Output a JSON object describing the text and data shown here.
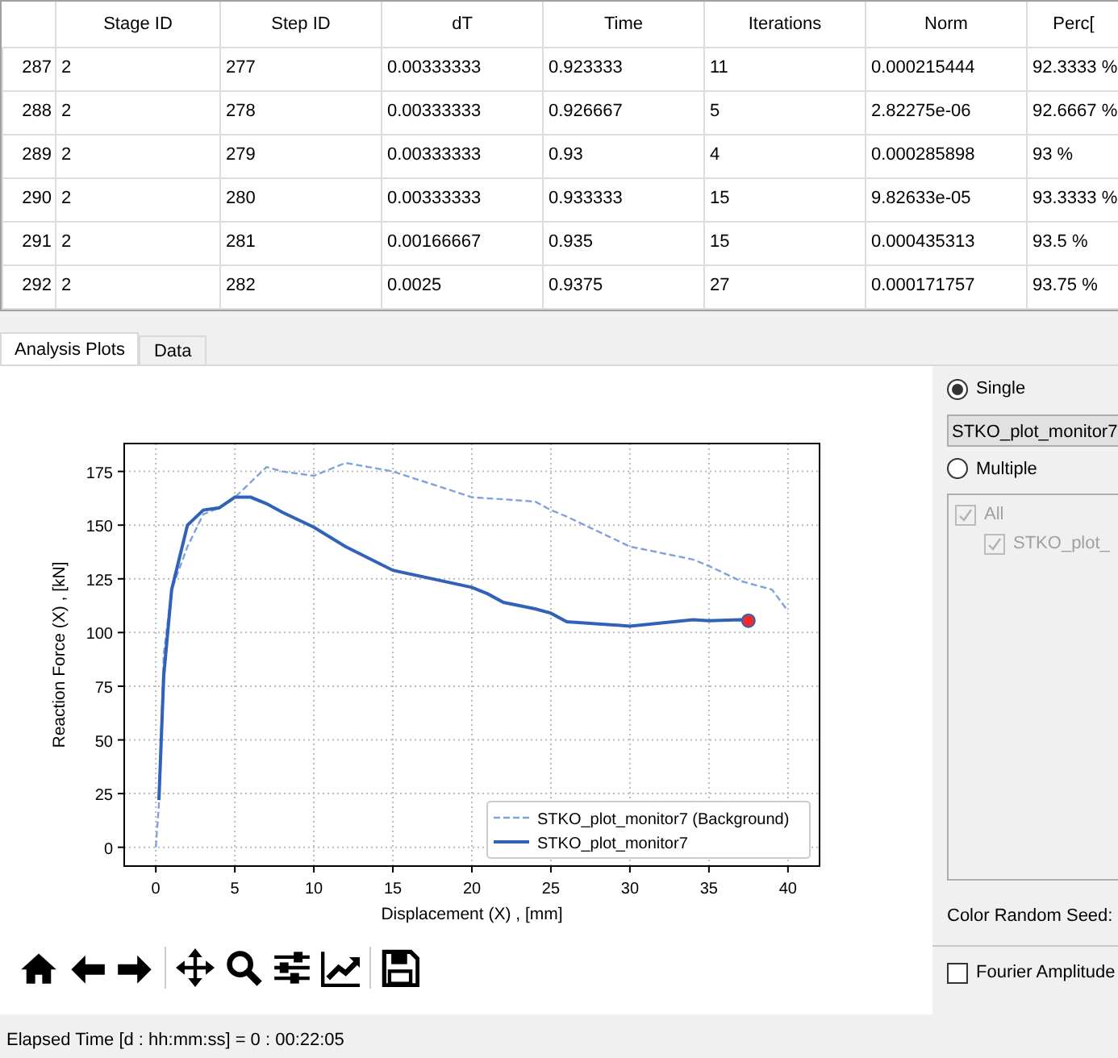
{
  "table": {
    "columns": [
      "",
      "Stage ID",
      "Step ID",
      "dT",
      "Time",
      "Iterations",
      "Norm",
      "Perc["
    ],
    "rows": [
      [
        "287",
        "2",
        "277",
        "0.00333333",
        "0.923333",
        "11",
        "0.000215444",
        "92.3333 %"
      ],
      [
        "288",
        "2",
        "278",
        "0.00333333",
        "0.926667",
        "5",
        "2.82275e-06",
        "92.6667 %"
      ],
      [
        "289",
        "2",
        "279",
        "0.00333333",
        "0.93",
        "4",
        "0.000285898",
        "93 %"
      ],
      [
        "290",
        "2",
        "280",
        "0.00333333",
        "0.933333",
        "15",
        "9.82633e-05",
        "93.3333 %"
      ],
      [
        "291",
        "2",
        "281",
        "0.00166667",
        "0.935",
        "15",
        "0.000435313",
        "93.5 %"
      ],
      [
        "292",
        "2",
        "282",
        "0.0025",
        "0.9375",
        "27",
        "0.000171757",
        "93.75 %"
      ]
    ]
  },
  "tabs": [
    {
      "label": "Analysis Plots",
      "selected": true
    },
    {
      "label": "Data",
      "selected": false
    }
  ],
  "chart_data": {
    "type": "line",
    "xlabel": "Displacement (X) , [mm]",
    "ylabel": "Reaction Force (X) , [kN]",
    "x": [
      0,
      0.2,
      0.5,
      1,
      2,
      3,
      4,
      5,
      6,
      7,
      8,
      10,
      12,
      15,
      20,
      21,
      22,
      24,
      25,
      26,
      30,
      34,
      35,
      37,
      37.5,
      39,
      40
    ],
    "grid": true,
    "legend": true,
    "series": [
      {
        "name": "STKO_plot_monitor7 (Background)",
        "color": "#7ea3dc",
        "line_style": "dashed",
        "values": [
          0,
          20,
          90,
          120,
          140,
          155,
          158,
          163,
          170,
          177,
          175,
          173,
          179,
          175,
          163,
          162.5,
          162,
          161,
          157,
          154,
          140,
          134,
          131,
          124,
          123,
          120,
          110
        ]
      },
      {
        "name": "STKO_plot_monitor7",
        "color": "#2f62b8",
        "line_style": "solid",
        "values": [
          null,
          22,
          80,
          120,
          150,
          157,
          158,
          163,
          163,
          160,
          156,
          149,
          140,
          129,
          121,
          118,
          114,
          111,
          109,
          105,
          103,
          106,
          105.5,
          106,
          105.5,
          null,
          null
        ]
      }
    ],
    "xlim": [
      -2,
      42
    ],
    "ylim": [
      -8.75,
      188
    ],
    "xticks": [
      0,
      5,
      10,
      15,
      20,
      25,
      30,
      35,
      40
    ],
    "yticks": [
      0,
      25,
      50,
      75,
      100,
      125,
      150,
      175
    ]
  },
  "side": {
    "single": {
      "label": "Single",
      "selected": true
    },
    "dropdown": "STKO_plot_monitor7",
    "multiple": {
      "label": "Multiple",
      "selected": false
    },
    "tree": [
      {
        "label": "All",
        "checked": true,
        "children": [
          {
            "label": "STKO_plot_",
            "checked": true
          }
        ]
      }
    ],
    "seed_label": "Color Random Seed:",
    "fourier": {
      "label": "Fourier Amplitude",
      "checked": false
    }
  },
  "status_bar": "Elapsed Time [d : hh:mm:ss] = 0 : 00:22:05"
}
